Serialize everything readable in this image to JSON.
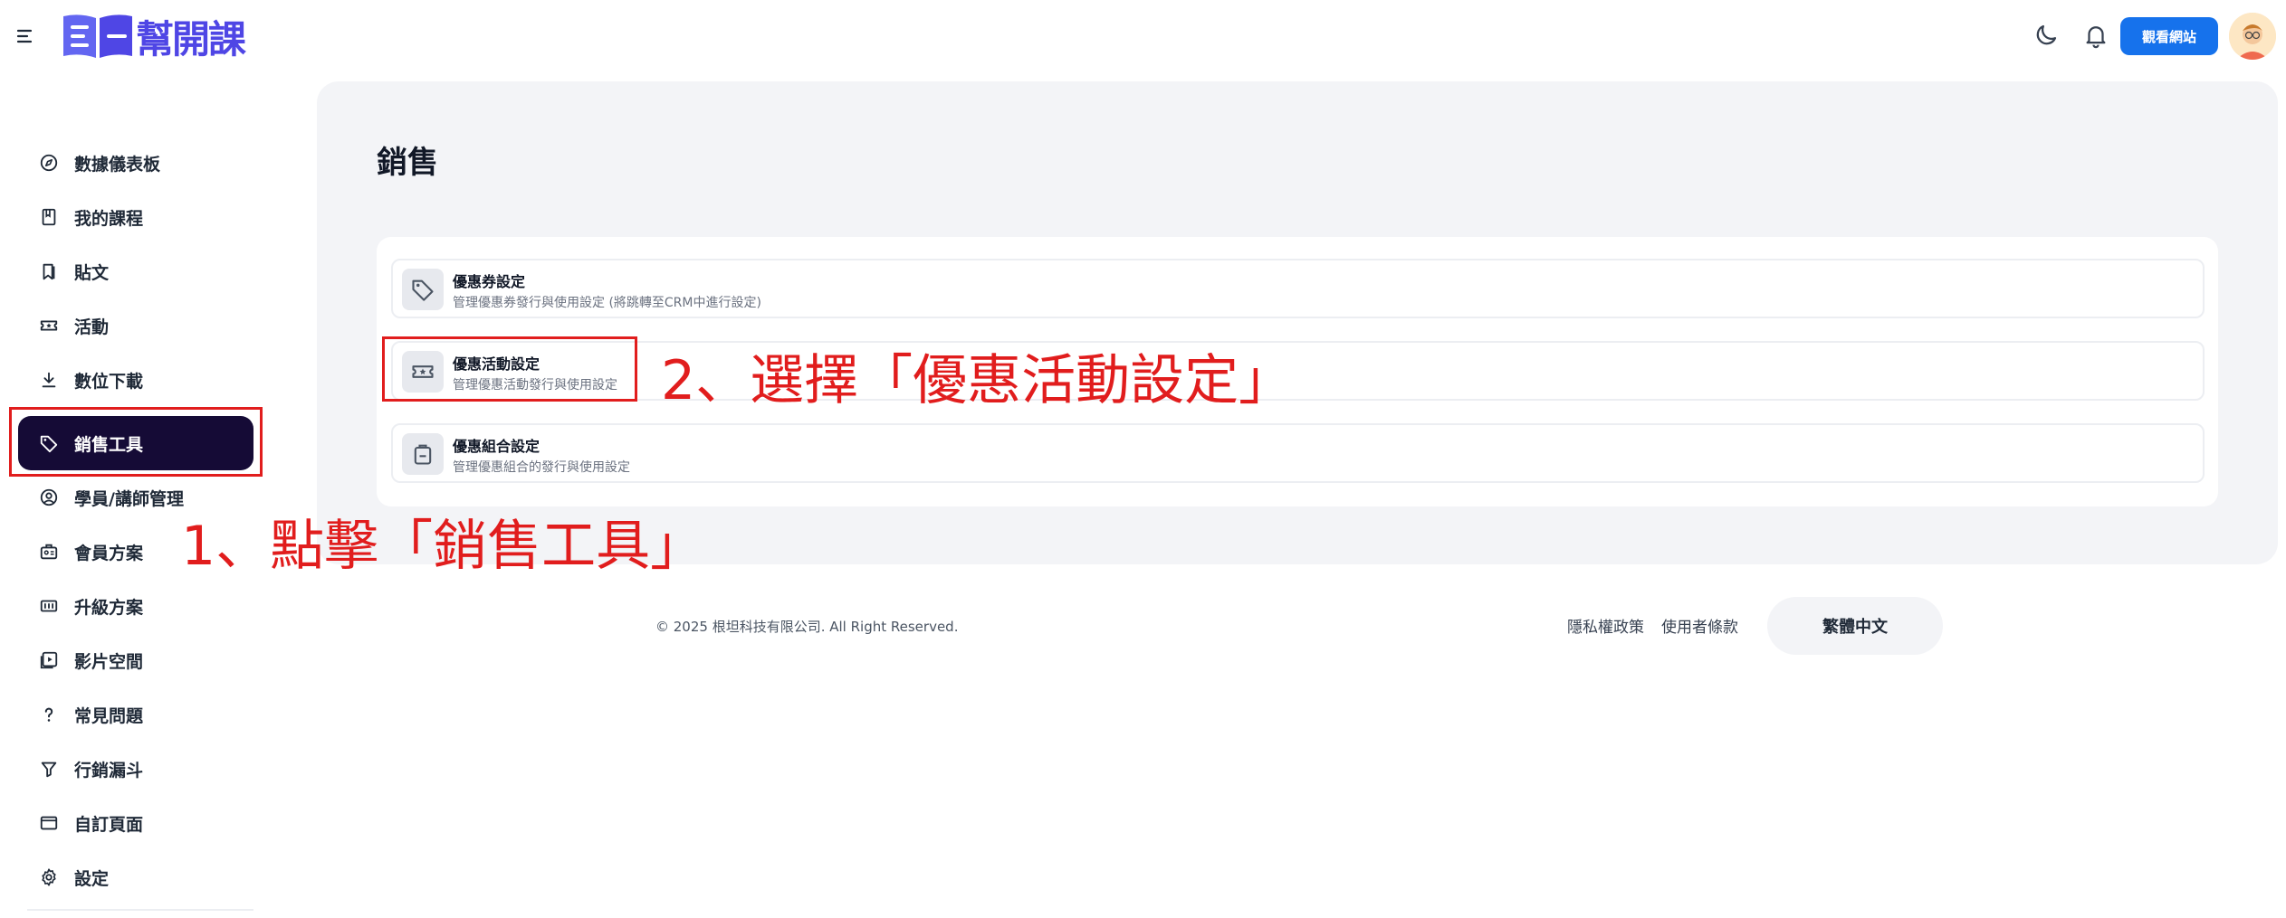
{
  "brand": {
    "name": "幫開課",
    "logo_color": "#4f46e5"
  },
  "header": {
    "menu_icon": "hamburger-icon",
    "theme_icon": "moon-icon",
    "notification_icon": "bell-icon",
    "view_site_label": "觀看網站",
    "accent_color": "#1672ec"
  },
  "sidebar": {
    "active_color": "#150b36",
    "items": [
      {
        "label": "數據儀表板",
        "icon": "compass-icon",
        "active": false
      },
      {
        "label": "我的課程",
        "icon": "book-icon",
        "active": false
      },
      {
        "label": "貼文",
        "icon": "bookmark-icon",
        "active": false
      },
      {
        "label": "活動",
        "icon": "ticket-icon",
        "active": false
      },
      {
        "label": "數位下載",
        "icon": "download-icon",
        "active": false
      },
      {
        "label": "銷售工具",
        "icon": "tag-icon",
        "active": true
      },
      {
        "label": "學員/講師管理",
        "icon": "user-circle-icon",
        "active": false
      },
      {
        "label": "會員方案",
        "icon": "id-badge-icon",
        "active": false
      },
      {
        "label": "升級方案",
        "icon": "plan-icon",
        "active": false
      },
      {
        "label": "影片空間",
        "icon": "video-icon",
        "active": false
      },
      {
        "label": "常見問題",
        "icon": "question-icon",
        "active": false
      },
      {
        "label": "行銷漏斗",
        "icon": "funnel-icon",
        "active": false
      },
      {
        "label": "自訂頁面",
        "icon": "window-icon",
        "active": false
      },
      {
        "label": "設定",
        "icon": "gear-icon",
        "active": false
      }
    ]
  },
  "main": {
    "title": "銷售",
    "tools": [
      {
        "title": "優惠券設定",
        "description": "管理優惠券發行與使用設定 (將跳轉至CRM中進行設定)",
        "icon": "tag-icon"
      },
      {
        "title": "優惠活動設定",
        "description": "管理優惠活動發行與使用設定",
        "icon": "ticket-icon"
      },
      {
        "title": "優惠組合設定",
        "description": "管理優惠組合的發行與使用設定",
        "icon": "bag-icon"
      }
    ]
  },
  "footer": {
    "copyright": "© 2025 根坦科技有限公司. All Right Reserved.",
    "privacy": "隱私權政策",
    "terms": "使用者條款",
    "language": "繁體中文"
  },
  "annotations": {
    "color": "#e11d1d",
    "step1": "1、點擊「銷售工具」",
    "step2": "2、選擇「優惠活動設定」"
  }
}
